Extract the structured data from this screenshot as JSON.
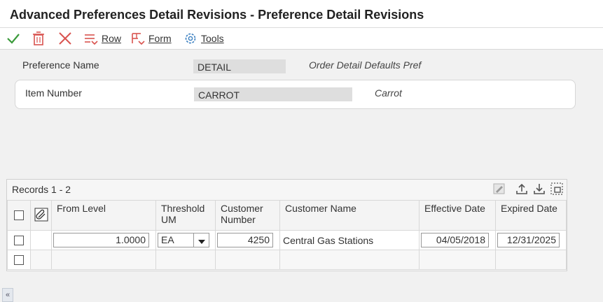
{
  "window": {
    "title": "Advanced Preferences Detail Revisions - Preference Detail Revisions"
  },
  "toolbar": {
    "ok_icon": "checkmark-icon",
    "delete_icon": "trash-icon",
    "cancel_icon": "close-icon",
    "row_label": "Row",
    "form_label": "Form",
    "tools_label": "Tools"
  },
  "header": {
    "preference_name_label": "Preference Name",
    "preference_name_value": "DETAIL",
    "preference_name_desc": "Order Detail Defaults Pref",
    "item_number_label": "Item Number",
    "item_number_value": "CARROT",
    "item_number_desc": "Carrot"
  },
  "grid": {
    "records_label": "Records 1 - 2",
    "columns": [
      {
        "key": "select",
        "label": ""
      },
      {
        "key": "attach",
        "label": ""
      },
      {
        "key": "from_level",
        "label": "From Level"
      },
      {
        "key": "threshold_um",
        "label": "Threshold UM"
      },
      {
        "key": "customer_number",
        "label": "Customer Number"
      },
      {
        "key": "customer_name",
        "label": "Customer Name"
      },
      {
        "key": "effective_date",
        "label": "Effective Date"
      },
      {
        "key": "expired_date",
        "label": "Expired Date"
      }
    ],
    "rows": [
      {
        "from_level": "1.0000",
        "threshold_um": "EA",
        "customer_number": "4250",
        "customer_name": "Central Gas Stations",
        "effective_date": "04/05/2018",
        "expired_date": "12/31/2025"
      }
    ]
  },
  "colors": {
    "accent_green": "#3a9a3a",
    "accent_red": "#d9534f",
    "tools_blue": "#3a7fc1"
  }
}
